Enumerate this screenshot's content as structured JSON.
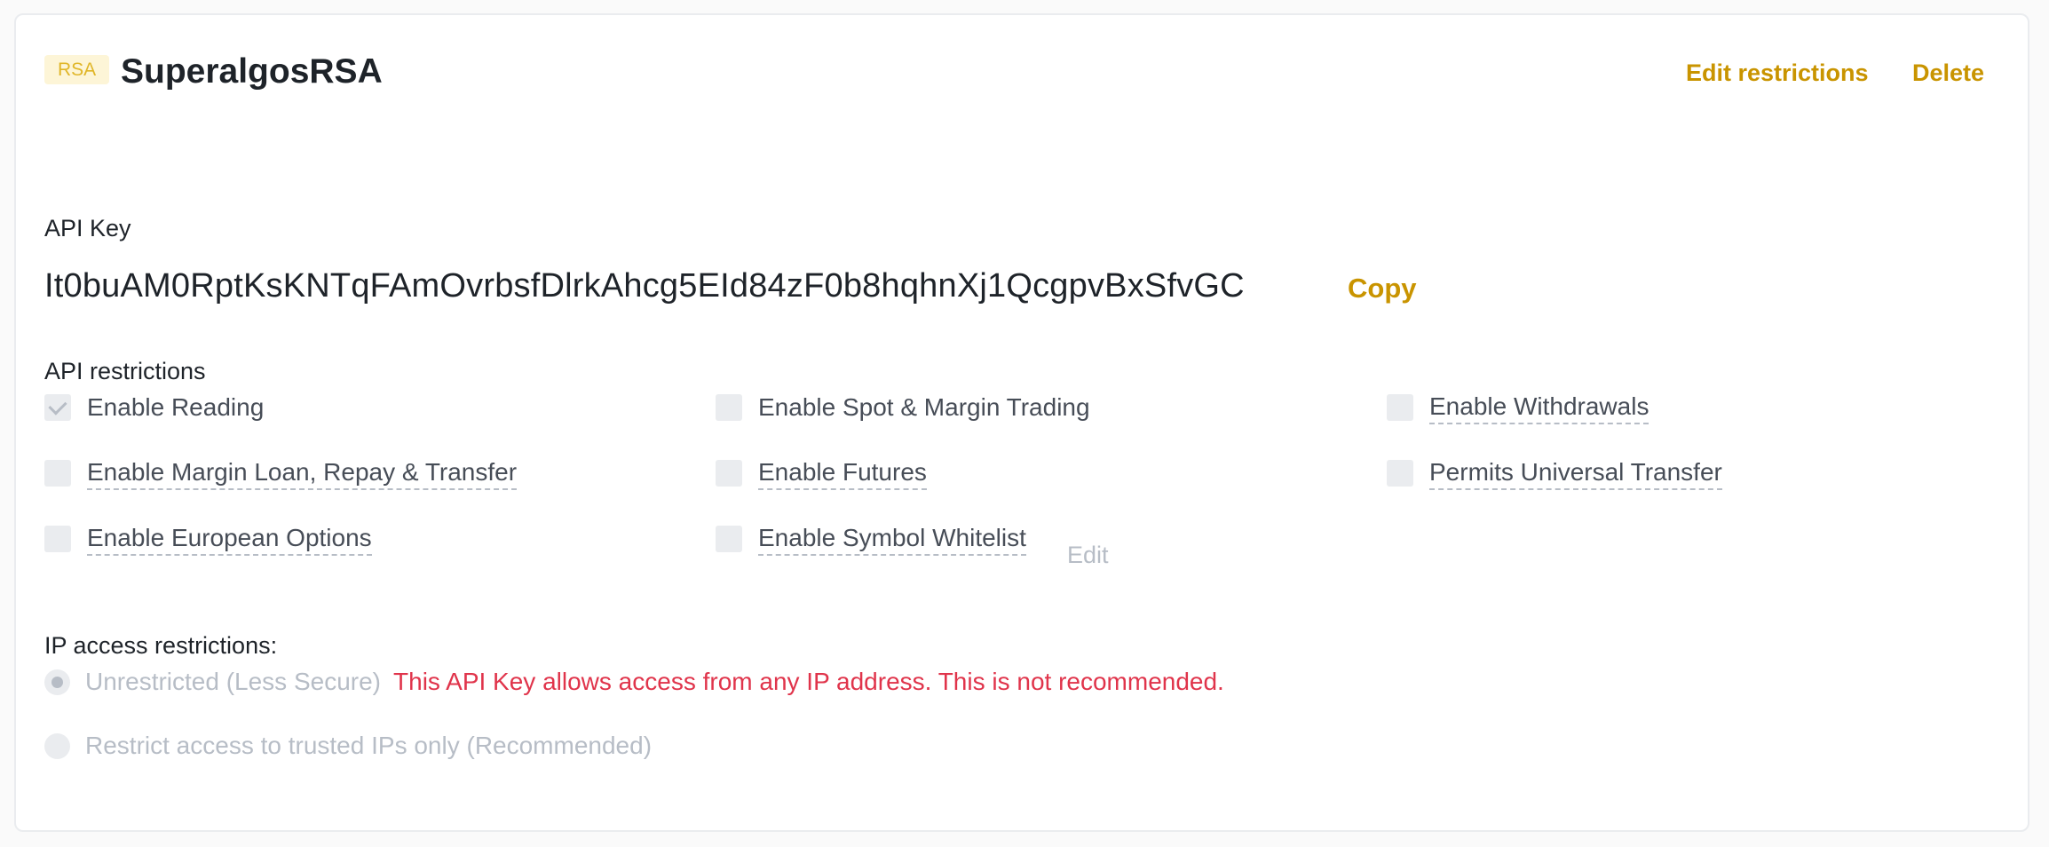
{
  "header": {
    "badge": "RSA",
    "name": "SuperalgosRSA",
    "edit_restrictions": "Edit restrictions",
    "delete": "Delete"
  },
  "api_key": {
    "label": "API Key",
    "value": "It0buAM0RptKsKNTqFAmOvrbsfDlrkAhcg5EId84zF0b8hqhnXj1QcgpvBxSfvGC",
    "copy": "Copy"
  },
  "restrictions": {
    "label": "API restrictions",
    "items": [
      {
        "label": "Enable Reading",
        "checked": true
      },
      {
        "label": "Enable Spot & Margin Trading",
        "checked": false
      },
      {
        "label": "Enable Withdrawals",
        "checked": false
      },
      {
        "label": "Enable Margin Loan, Repay & Transfer",
        "checked": false
      },
      {
        "label": "Enable Futures",
        "checked": false
      },
      {
        "label": "Permits Universal Transfer",
        "checked": false
      },
      {
        "label": "Enable European Options",
        "checked": false
      },
      {
        "label": "Enable Symbol Whitelist",
        "checked": false
      }
    ],
    "whitelist_edit": "Edit"
  },
  "ip_access": {
    "label": "IP access restrictions:",
    "options": [
      {
        "label": "Unrestricted (Less Secure)",
        "selected": true
      },
      {
        "label": "Restrict access to trusted IPs only (Recommended)",
        "selected": false
      }
    ],
    "warning": "This API Key allows access from any IP address. This is not recommended."
  },
  "colors": {
    "accent": "#c99400",
    "badge_bg": "#fdf5d7",
    "warning": "#e0344b",
    "disabled": "#b7bdc6"
  }
}
